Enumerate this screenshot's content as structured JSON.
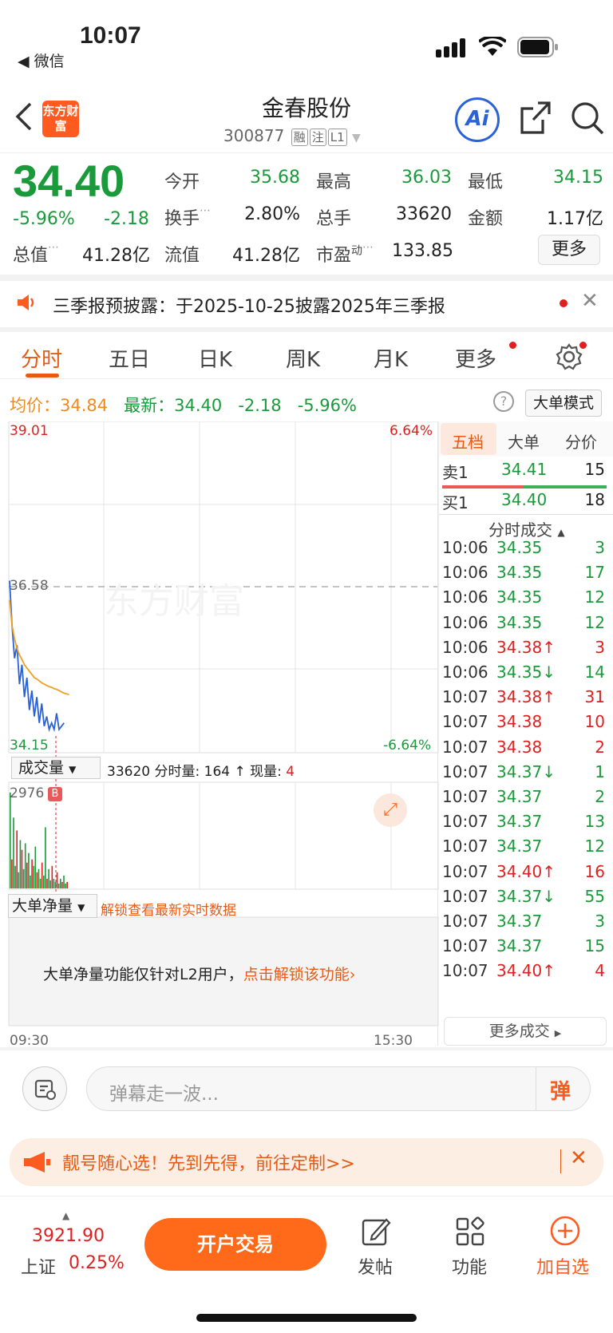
{
  "status_bar": {
    "time": "10:07",
    "back_app": "◀ 微信"
  },
  "header": {
    "logo": "东方财富",
    "title": "金春股份",
    "code": "300877",
    "tags": [
      "融",
      "注",
      "L1"
    ]
  },
  "quote": {
    "price": "34.40",
    "change_pct": "-5.96%",
    "change": "-2.18",
    "items": [
      {
        "label": "今开",
        "value": "35.68"
      },
      {
        "label": "最高",
        "value": "36.03"
      },
      {
        "label": "最低",
        "value": "34.15"
      },
      {
        "label": "换手",
        "value": "2.80%"
      },
      {
        "label": "总手",
        "value": "33620"
      },
      {
        "label": "金额",
        "value": "1.17亿"
      },
      {
        "label": "总值",
        "value": "41.28亿"
      },
      {
        "label": "流值",
        "value": "41.28亿"
      },
      {
        "label": "市盈",
        "value": "133.85"
      }
    ],
    "pe_sup": "动",
    "more_label": "更多"
  },
  "notice": {
    "text": "三季报预披露：于2025-10-25披露2025年三季报"
  },
  "tabs": [
    "分时",
    "五日",
    "日K",
    "周K",
    "月K",
    "更多"
  ],
  "summary": {
    "avg_label": "均价：",
    "avg": "34.84",
    "latest_label": "最新：",
    "latest": "34.40",
    "chg": "-2.18",
    "pct": "-5.96%",
    "mode_btn": "大单模式"
  },
  "chart_data": {
    "type": "line",
    "y_top": "39.01",
    "y_mid": "36.58",
    "y_bot": "34.15",
    "pct_top": "6.64%",
    "pct_bot": "-6.64%",
    "x_start": "09:30",
    "x_end": "15:30",
    "ylim": [
      34.15,
      39.01
    ],
    "series": [
      {
        "values": [
          36.6,
          35.9,
          35.4,
          35.6,
          35.0,
          35.3,
          34.8,
          35.1,
          34.6,
          34.9,
          34.5,
          34.8,
          34.4,
          34.7,
          34.35,
          34.5,
          34.3,
          34.4,
          34.3,
          34.55,
          34.3,
          34.35,
          34.4
        ]
      },
      {
        "values": [
          36.3,
          35.9,
          35.7,
          35.55,
          35.45,
          35.38,
          35.3,
          35.25,
          35.2,
          35.15,
          35.1,
          35.08,
          35.05,
          35.02,
          35.0,
          34.98,
          34.96,
          34.95,
          34.93,
          34.92,
          34.9,
          34.88,
          34.86,
          34.85,
          34.84
        ]
      }
    ],
    "volume_label": "成交量",
    "volume_total": "33620",
    "volume_min_label": "分时量:",
    "volume_min": "164",
    "arrow": "↑",
    "volume_now_label": "现量:",
    "volume_now": "4",
    "volume_max": "2976",
    "b_flag": "B",
    "volume_values": [
      2976,
      900,
      2200,
      700,
      1800,
      500,
      1500,
      1200,
      600,
      1400,
      800,
      1100,
      400,
      900,
      700,
      1300,
      500,
      600,
      300,
      800,
      400,
      1900,
      300,
      600,
      250,
      700,
      300,
      200,
      500,
      150,
      300,
      200,
      400,
      150,
      200
    ]
  },
  "net_flow": {
    "label": "大单净量",
    "unlock": "解锁查看最新实时数据",
    "msg": "大单净量功能仅针对L2用户，",
    "msg_link": "点击解锁该功能›"
  },
  "order_book": {
    "tabs": [
      "五档",
      "大单",
      "分价"
    ],
    "sell1": {
      "label": "卖1",
      "price": "34.41",
      "vol": "15"
    },
    "buy1": {
      "label": "买1",
      "price": "34.40",
      "vol": "18"
    },
    "trades_header": "分时成交",
    "trades": [
      {
        "t": "10:06",
        "p": "34.35",
        "d": "",
        "v": "3",
        "c": "green"
      },
      {
        "t": "10:06",
        "p": "34.35",
        "d": "",
        "v": "17",
        "c": "green"
      },
      {
        "t": "10:06",
        "p": "34.35",
        "d": "",
        "v": "12",
        "c": "green"
      },
      {
        "t": "10:06",
        "p": "34.35",
        "d": "",
        "v": "12",
        "c": "green"
      },
      {
        "t": "10:06",
        "p": "34.38",
        "d": "↑",
        "v": "3",
        "c": "red"
      },
      {
        "t": "10:06",
        "p": "34.35",
        "d": "↓",
        "v": "14",
        "c": "green"
      },
      {
        "t": "10:07",
        "p": "34.38",
        "d": "↑",
        "v": "31",
        "c": "red"
      },
      {
        "t": "10:07",
        "p": "34.38",
        "d": "",
        "v": "10",
        "c": "red"
      },
      {
        "t": "10:07",
        "p": "34.38",
        "d": "",
        "v": "2",
        "c": "red"
      },
      {
        "t": "10:07",
        "p": "34.37",
        "d": "↓",
        "v": "1",
        "c": "green"
      },
      {
        "t": "10:07",
        "p": "34.37",
        "d": "",
        "v": "2",
        "c": "green"
      },
      {
        "t": "10:07",
        "p": "34.37",
        "d": "",
        "v": "13",
        "c": "green"
      },
      {
        "t": "10:07",
        "p": "34.37",
        "d": "",
        "v": "12",
        "c": "green"
      },
      {
        "t": "10:07",
        "p": "34.40",
        "d": "↑",
        "v": "16",
        "c": "red"
      },
      {
        "t": "10:07",
        "p": "34.37",
        "d": "↓",
        "v": "55",
        "c": "green"
      },
      {
        "t": "10:07",
        "p": "34.37",
        "d": "",
        "v": "3",
        "c": "green"
      },
      {
        "t": "10:07",
        "p": "34.37",
        "d": "",
        "v": "15",
        "c": "green"
      },
      {
        "t": "10:07",
        "p": "34.40",
        "d": "↑",
        "v": "4",
        "c": "red"
      }
    ],
    "more": "更多成交"
  },
  "danmu": {
    "placeholder": "弹幕走一波...",
    "btn": "弹"
  },
  "ad": {
    "text": "靓号随心选！先到先得，前往定制>>"
  },
  "bottom": {
    "index_value": "3921.90",
    "index_name": "上证",
    "index_pct": "0.25%",
    "open_btn": "开户交易",
    "post": "发帖",
    "func": "功能",
    "add": "加自选"
  },
  "colors": {
    "up": "#e02020",
    "down": "#1a9a3a",
    "accent": "#ff6a1a",
    "avg": "#f0a020",
    "line": "#2a62d8"
  }
}
